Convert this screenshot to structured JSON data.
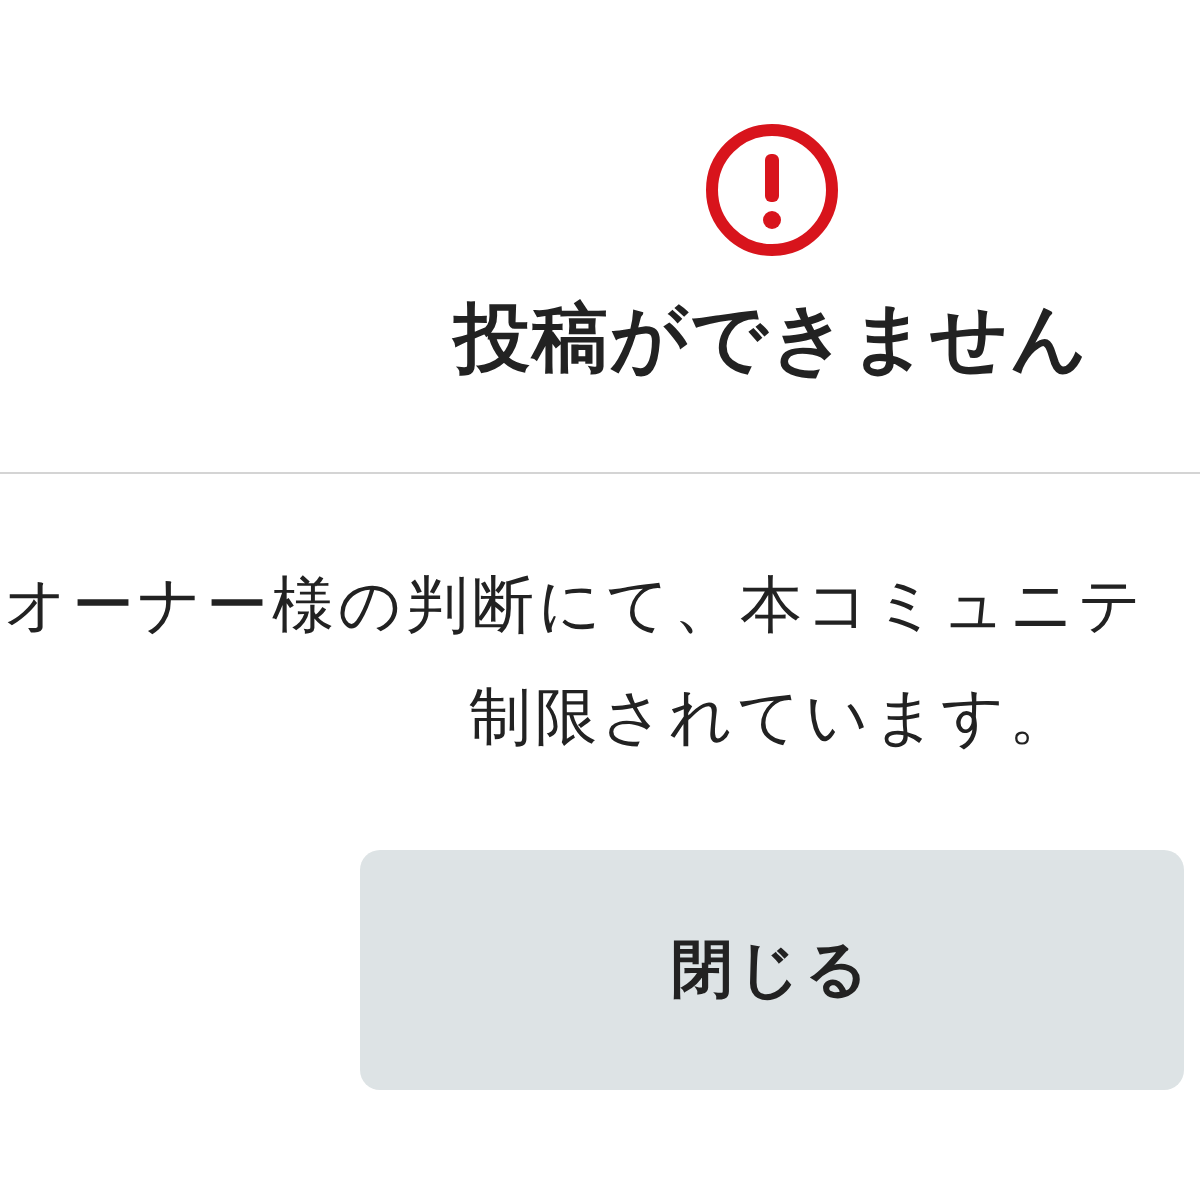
{
  "dialog": {
    "title": "投稿ができません",
    "message_lines": [
      "オーナー様の判断にて、本コミュニテ",
      "制限されています。"
    ],
    "buttons": [
      {
        "label": "閉じる"
      }
    ]
  }
}
